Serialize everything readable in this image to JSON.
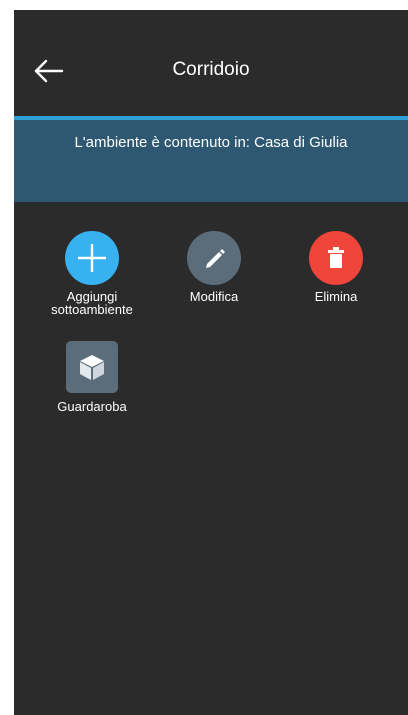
{
  "header": {
    "title": "Corridoio",
    "back_icon": "arrow-left-icon"
  },
  "banner": {
    "text": "L'ambiente è contenuto in: Casa di Giulia"
  },
  "actions": [
    {
      "label_line1": "Aggiungi",
      "label_line2": "sottoambiente",
      "icon": "plus-icon",
      "color": "#37b1f0"
    },
    {
      "label": "Modifica",
      "icon": "pencil-icon",
      "color": "#5b6d7b"
    },
    {
      "label": "Elimina",
      "icon": "trash-icon",
      "color": "#f0453a"
    }
  ],
  "subrooms": [
    {
      "label": "Guardaroba",
      "icon": "cube-icon"
    }
  ],
  "colors": {
    "background": "#2b2b2b",
    "accent": "#2f9fd8",
    "banner": "#2e5872"
  }
}
